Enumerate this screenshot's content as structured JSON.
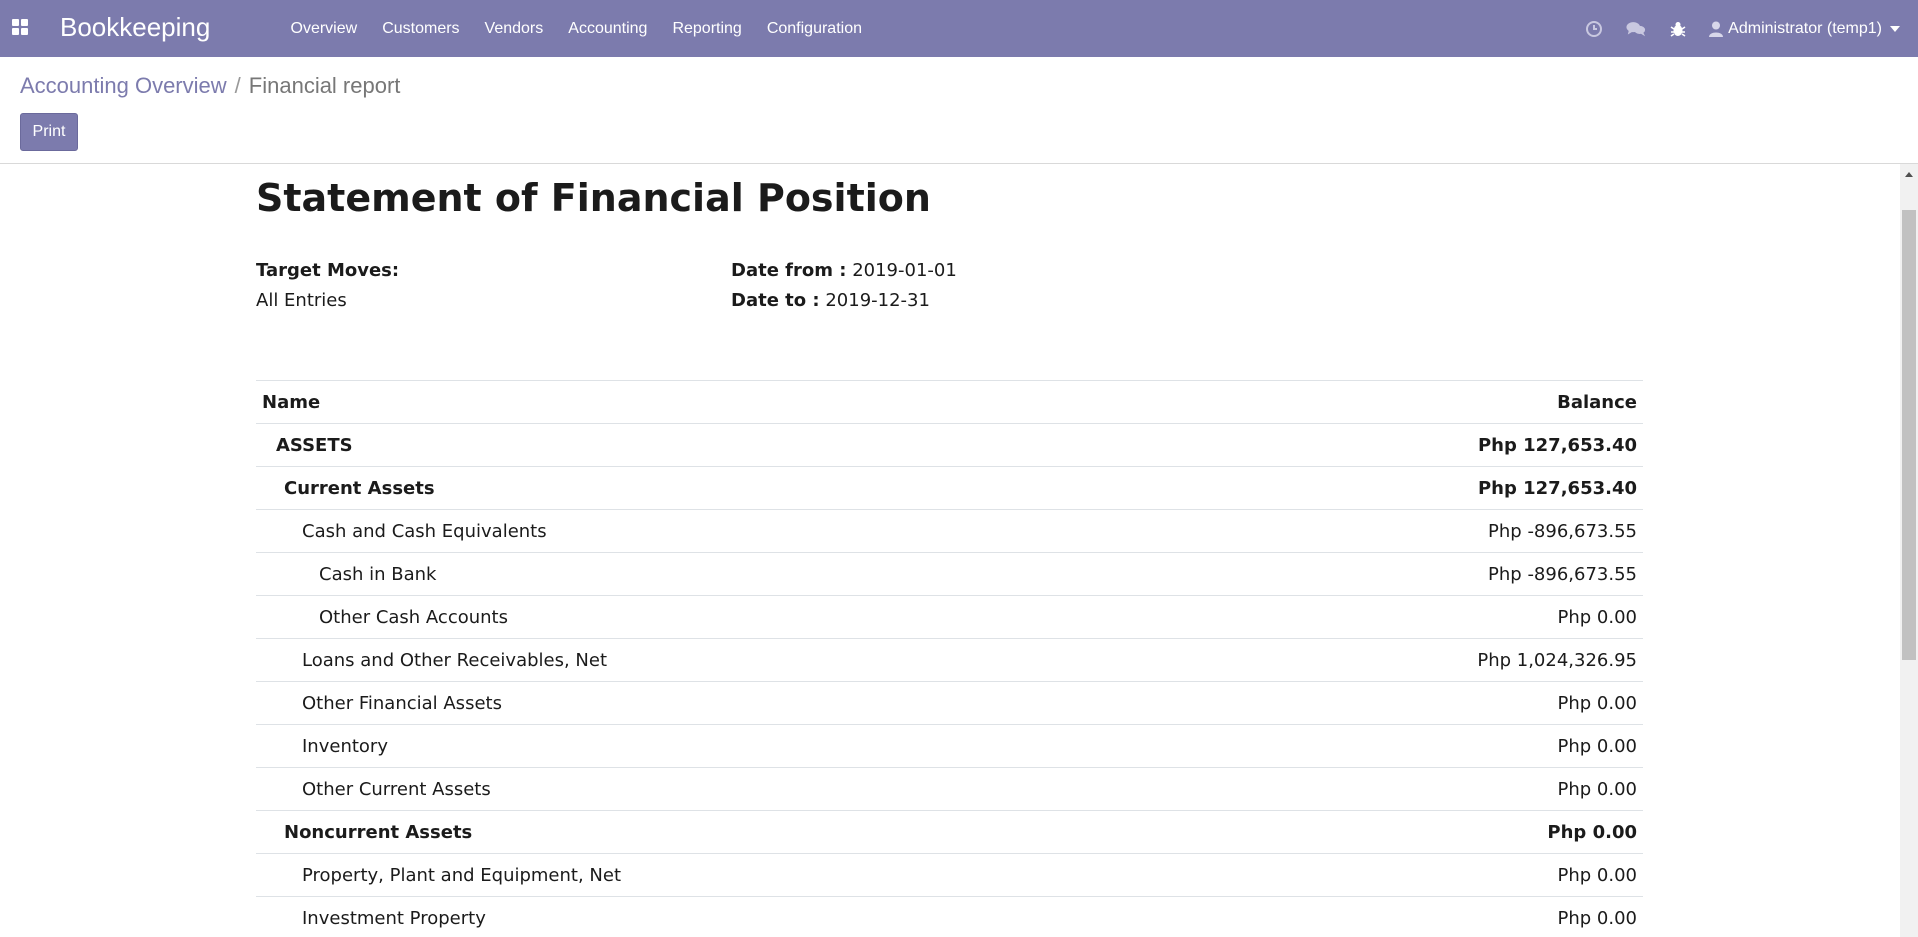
{
  "app": {
    "brand": "Bookkeeping"
  },
  "navbar": {
    "menu": [
      "Overview",
      "Customers",
      "Vendors",
      "Accounting",
      "Reporting",
      "Configuration"
    ],
    "user": "Administrator (temp1)"
  },
  "breadcrumb": {
    "parent": "Accounting Overview",
    "separator": "/",
    "current": "Financial report"
  },
  "actions": {
    "print_label": "Print"
  },
  "report": {
    "title": "Statement of Financial Position",
    "target_moves_label": "Target Moves:",
    "target_moves_value": "All Entries",
    "date_from_label": "Date from :",
    "date_from_value": "2019-01-01",
    "date_to_label": "Date to :",
    "date_to_value": "2019-12-31",
    "columns": {
      "name": "Name",
      "balance": "Balance"
    },
    "rows": [
      {
        "name": "ASSETS",
        "balance": "Php 127,653.40",
        "level": 1,
        "bold": true
      },
      {
        "name": "Current Assets",
        "balance": "Php 127,653.40",
        "level": 2,
        "bold": true
      },
      {
        "name": "Cash and Cash Equivalents",
        "balance": "Php -896,673.55",
        "level": 3,
        "bold": false
      },
      {
        "name": "Cash in Bank",
        "balance": "Php -896,673.55",
        "level": 4,
        "bold": false
      },
      {
        "name": "Other Cash Accounts",
        "balance": "Php 0.00",
        "level": 4,
        "bold": false
      },
      {
        "name": "Loans and Other Receivables, Net",
        "balance": "Php 1,024,326.95",
        "level": 3,
        "bold": false
      },
      {
        "name": "Other Financial Assets",
        "balance": "Php 0.00",
        "level": 3,
        "bold": false
      },
      {
        "name": "Inventory",
        "balance": "Php 0.00",
        "level": 3,
        "bold": false
      },
      {
        "name": "Other Current Assets",
        "balance": "Php 0.00",
        "level": 3,
        "bold": false
      },
      {
        "name": "Noncurrent Assets",
        "balance": "Php 0.00",
        "level": 2,
        "bold": true
      },
      {
        "name": "Property, Plant and Equipment, Net",
        "balance": "Php 0.00",
        "level": 3,
        "bold": false
      },
      {
        "name": "Investment Property",
        "balance": "Php 0.00",
        "level": 3,
        "bold": false
      }
    ]
  },
  "colors": {
    "navbar": "#7c7bad",
    "link": "#7c7bad",
    "text": "#1b1b1b"
  }
}
